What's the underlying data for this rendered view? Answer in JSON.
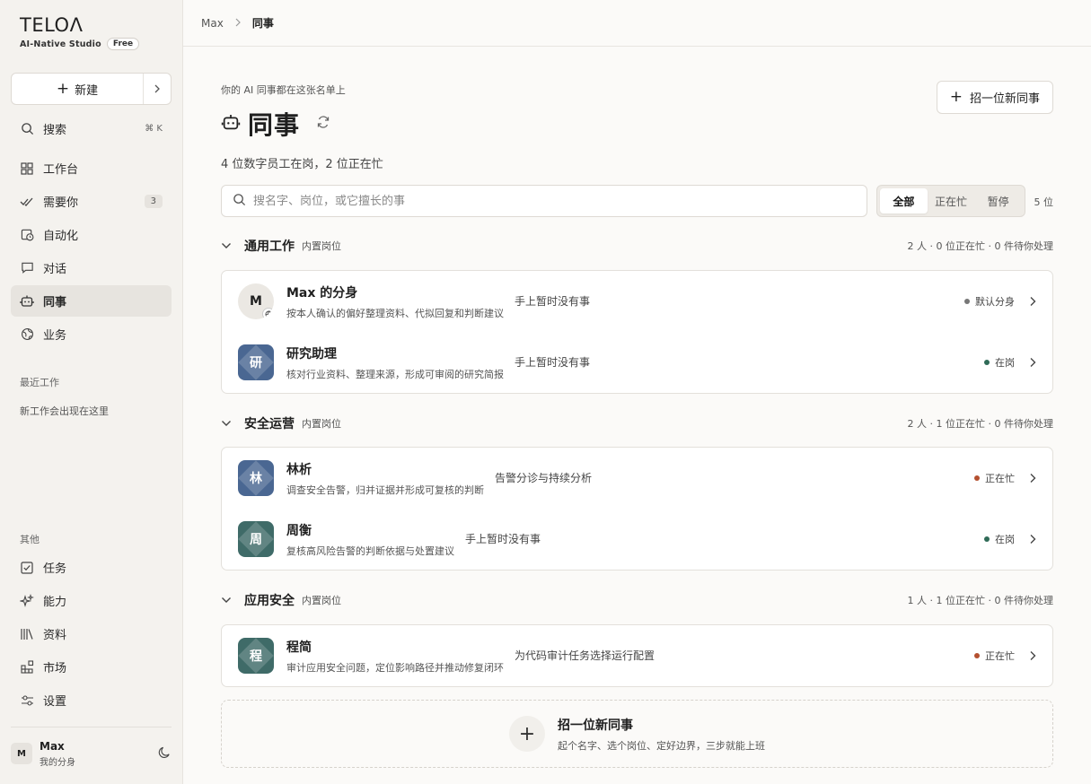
{
  "app": {
    "logo": "TELOΛ",
    "studio": "AI-Native Studio",
    "plan": "Free"
  },
  "sidebar": {
    "new_label": "新建",
    "search_label": "搜索",
    "search_shortcut": "⌘ K",
    "items": [
      {
        "label": "工作台",
        "icon": "grid-icon"
      },
      {
        "label": "需要你",
        "icon": "double-check-icon",
        "badge": "3"
      },
      {
        "label": "自动化",
        "icon": "calendar-clock-icon"
      },
      {
        "label": "对话",
        "icon": "chat-icon"
      },
      {
        "label": "同事",
        "icon": "robot-icon",
        "active": true
      },
      {
        "label": "业务",
        "icon": "globe-icon"
      }
    ],
    "recent_label": "最近工作",
    "recent_empty": "新工作会出现在这里",
    "other_label": "其他",
    "other_items": [
      {
        "label": "任务",
        "icon": "checkbox-icon"
      },
      {
        "label": "能力",
        "icon": "sparkle-icon"
      },
      {
        "label": "资料",
        "icon": "library-icon"
      },
      {
        "label": "市场",
        "icon": "apps-icon"
      },
      {
        "label": "设置",
        "icon": "sliders-icon"
      }
    ],
    "user": {
      "initial": "M",
      "name": "Max",
      "sub": "我的分身"
    }
  },
  "breadcrumb": {
    "parent": "Max",
    "current": "同事"
  },
  "page": {
    "eyebrow": "你的 AI 同事都在这张名单上",
    "title": "同事",
    "subtitle": "4 位数字员工在岗，2 位正在忙",
    "recruit_label": "招一位新同事",
    "search_placeholder": "搜名字、岗位，或它擅长的事",
    "filters": [
      "全部",
      "正在忙",
      "暂停"
    ],
    "count": "5 位"
  },
  "groups": [
    {
      "name": "通用工作",
      "tag": "内置岗位",
      "stat": "2 人 · 0 位正在忙 · 0 件待你处理",
      "members": [
        {
          "initial": "M",
          "name": "Max 的分身",
          "desc": "按本人确认的偏好整理资料、代拟回复和判断建议",
          "task": "手上暂时没有事",
          "status": "默认分身",
          "dot": "#777777",
          "self": true
        },
        {
          "initial": "研",
          "name": "研究助理",
          "desc": "核对行业资料、整理来源，形成可审阅的研究简报",
          "task": "手上暂时没有事",
          "status": "在岗",
          "dot": "#2f6b57",
          "color": "#4a6792"
        }
      ]
    },
    {
      "name": "安全运营",
      "tag": "内置岗位",
      "stat": "2 人 · 1 位正在忙 · 0 件待你处理",
      "members": [
        {
          "initial": "林",
          "name": "林析",
          "desc": "调查安全告警，归并证据并形成可复核的判断",
          "task": "告警分诊与持续分析",
          "status": "正在忙",
          "dot": "#b4502f",
          "color": "#4a6792"
        },
        {
          "initial": "周",
          "name": "周衡",
          "desc": "复核高风险告警的判断依据与处置建议",
          "task": "手上暂时没有事",
          "status": "在岗",
          "dot": "#2f6b57",
          "color": "#3f6b68"
        }
      ]
    },
    {
      "name": "应用安全",
      "tag": "内置岗位",
      "stat": "1 人 · 1 位正在忙 · 0 件待你处理",
      "members": [
        {
          "initial": "程",
          "name": "程简",
          "desc": "审计应用安全问题，定位影响路径并推动修复闭环",
          "task": "为代码审计任务选择运行配置",
          "status": "正在忙",
          "dot": "#b4502f",
          "color": "#3f6b68"
        }
      ]
    }
  ],
  "recruit_card": {
    "title": "招一位新同事",
    "desc": "起个名字、选个岗位、定好边界，三步就能上班"
  }
}
